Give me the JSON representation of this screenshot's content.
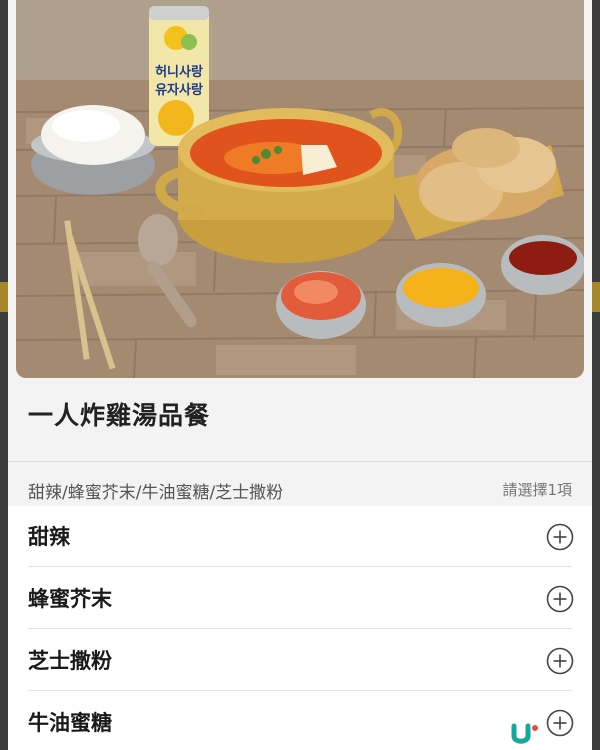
{
  "product": {
    "title": "一人炸雞湯品餐",
    "photo_drink_label": [
      "허니사랑",
      "유자사랑"
    ]
  },
  "option_group": {
    "title": "甜辣/蜂蜜芥末/牛油蜜糖/芝士撒粉",
    "hint": "請選擇1項"
  },
  "options": [
    {
      "label": "甜辣",
      "action_icon": "plus-circle-icon"
    },
    {
      "label": "蜂蜜芥末",
      "action_icon": "plus-circle-icon"
    },
    {
      "label": "芝士撒粉",
      "action_icon": "plus-circle-icon"
    },
    {
      "label": "牛油蜜糖",
      "action_icon": "plus-circle-icon"
    }
  ],
  "watermark": {
    "icon": "u-logo-icon"
  },
  "colors": {
    "accent_gold": "#a8872a",
    "background": "#f3f3f3",
    "text_primary": "#1a1a1a",
    "text_secondary": "#777777"
  }
}
